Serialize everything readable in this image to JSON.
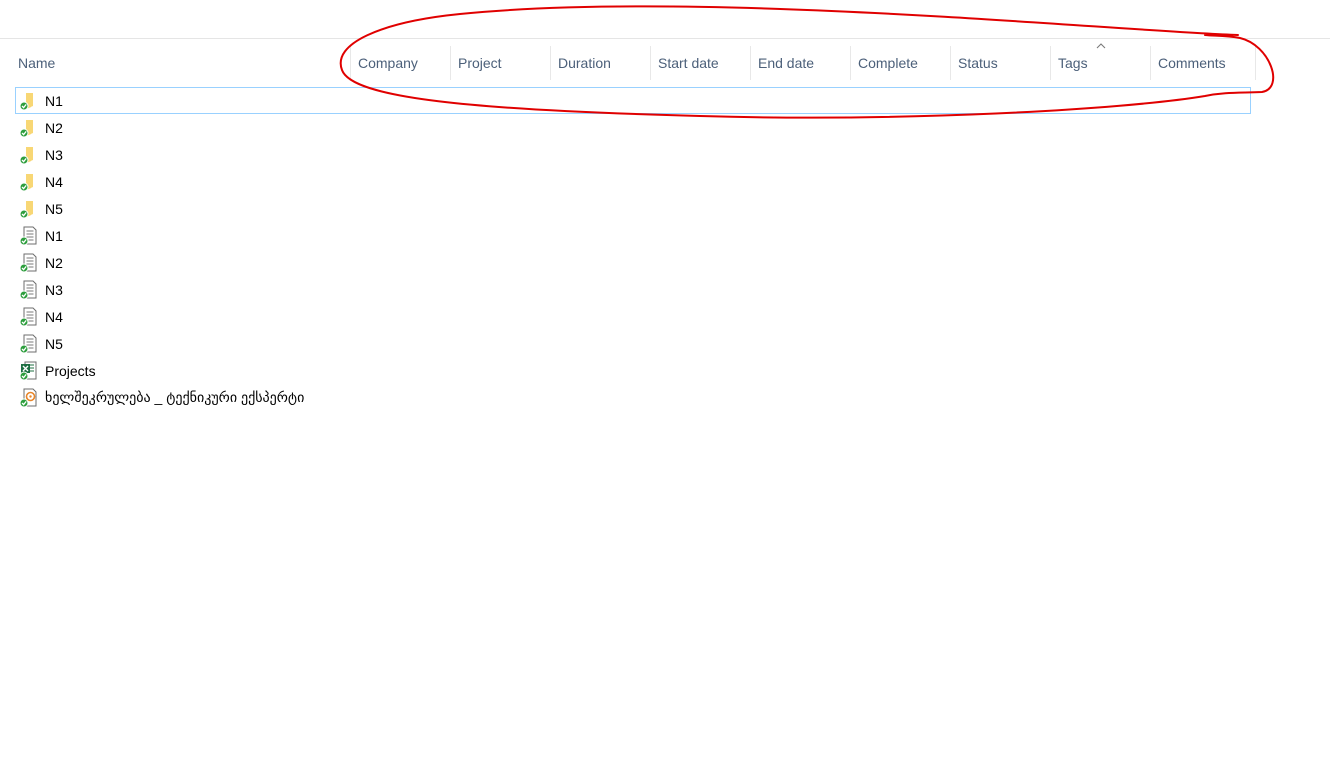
{
  "columns": [
    {
      "key": "name",
      "label": "Name"
    },
    {
      "key": "company",
      "label": "Company"
    },
    {
      "key": "project",
      "label": "Project"
    },
    {
      "key": "duration",
      "label": "Duration"
    },
    {
      "key": "start_date",
      "label": "Start date"
    },
    {
      "key": "end_date",
      "label": "End date"
    },
    {
      "key": "complete",
      "label": "Complete"
    },
    {
      "key": "status",
      "label": "Status"
    },
    {
      "key": "tags",
      "label": "Tags"
    },
    {
      "key": "comments",
      "label": "Comments"
    }
  ],
  "sort": {
    "column": "tags",
    "direction": "ascending",
    "icon": "chevron-up-icon"
  },
  "files": [
    {
      "name": "N1",
      "icon": "folder-icon",
      "sync_status": "synced",
      "selected": true
    },
    {
      "name": "N2",
      "icon": "folder-icon",
      "sync_status": "synced"
    },
    {
      "name": "N3",
      "icon": "folder-icon",
      "sync_status": "synced"
    },
    {
      "name": "N4",
      "icon": "folder-icon",
      "sync_status": "synced"
    },
    {
      "name": "N5",
      "icon": "folder-icon",
      "sync_status": "synced"
    },
    {
      "name": "N1",
      "icon": "document-icon",
      "sync_status": "synced"
    },
    {
      "name": "N2",
      "icon": "document-icon",
      "sync_status": "synced"
    },
    {
      "name": "N3",
      "icon": "document-icon",
      "sync_status": "synced"
    },
    {
      "name": "N4",
      "icon": "document-icon",
      "sync_status": "synced"
    },
    {
      "name": "N5",
      "icon": "document-icon",
      "sync_status": "synced"
    },
    {
      "name": "Projects",
      "icon": "excel-icon",
      "sync_status": "synced"
    },
    {
      "name": "ხელშეკრულება _ ტექნიკური ექსპერტი",
      "icon": "media-file-icon",
      "sync_status": "synced"
    }
  ],
  "colors": {
    "header_text": "#4c607a",
    "selection_border": "#99d1ff",
    "sync_check": "#2e9e3e",
    "folder": "#f8d775",
    "excel": "#1d6f42",
    "annotation": "#e00000"
  }
}
